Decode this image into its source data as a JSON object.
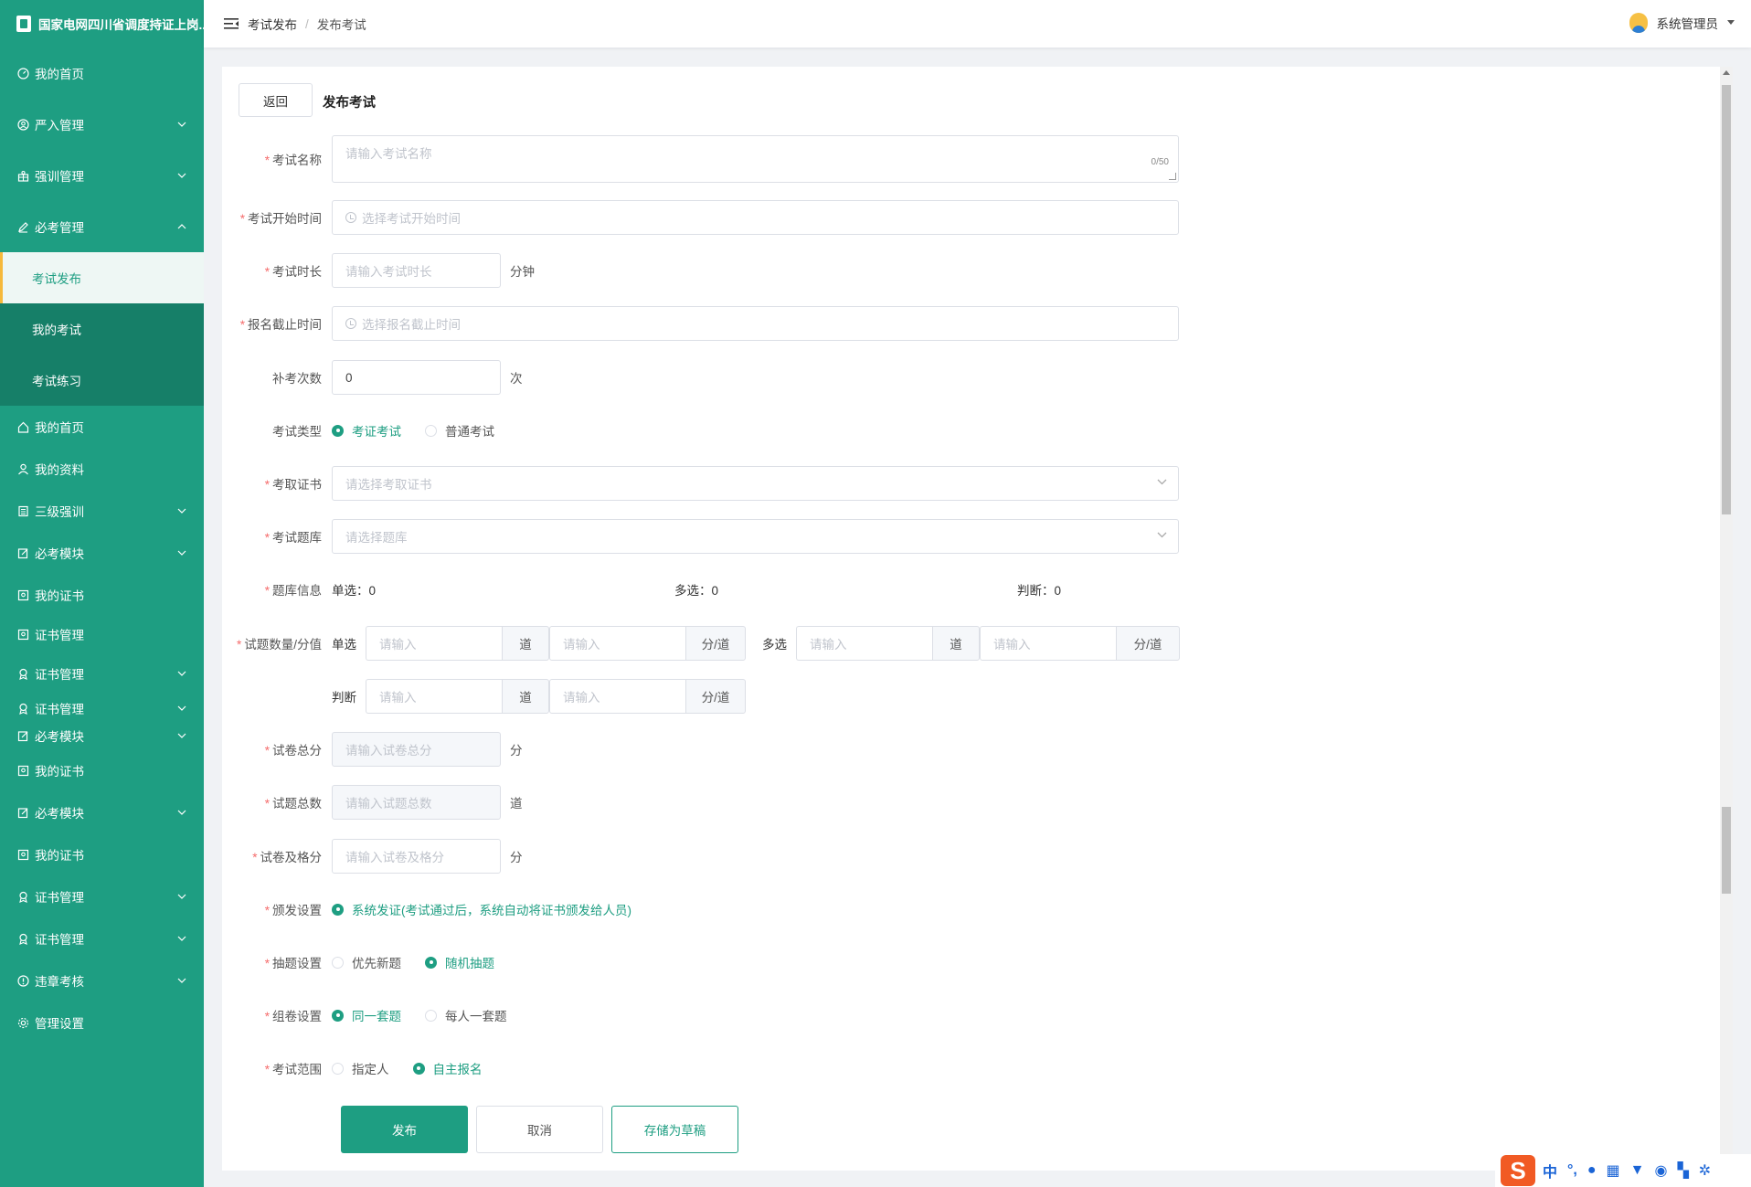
{
  "app": {
    "title": "国家电网四川省调度持证上岗..."
  },
  "header": {
    "breadcrumb": [
      "考试发布",
      "发布考试"
    ],
    "user_name": "系统管理员"
  },
  "sidebar": {
    "items": [
      {
        "label": "我的首页",
        "icon": "dashboard-icon",
        "chevron": false
      },
      {
        "label": "严入管理",
        "icon": "user-circle-icon",
        "chevron": true
      },
      {
        "label": "强训管理",
        "icon": "gift-icon",
        "chevron": true
      },
      {
        "label": "必考管理",
        "icon": "edit-icon",
        "chevron": true,
        "expanded": true
      }
    ],
    "sub_items": [
      {
        "label": "考试发布",
        "active": true
      },
      {
        "label": "我的考试",
        "active": false
      },
      {
        "label": "考试练习",
        "active": false
      }
    ],
    "items2": [
      {
        "label": "我的首页",
        "icon": "home-icon",
        "chevron": false
      },
      {
        "label": "我的资料",
        "icon": "user-icon",
        "chevron": false
      },
      {
        "label": "三级强训",
        "icon": "document-icon",
        "chevron": true
      },
      {
        "label": "必考模块",
        "icon": "edit-box-icon",
        "chevron": true
      },
      {
        "label": "我的证书",
        "icon": "certificate-icon",
        "chevron": false
      },
      {
        "label": "证书管理",
        "icon": "certificate-icon",
        "chevron": false
      },
      {
        "label": "证书管理",
        "icon": "badge-icon",
        "chevron": true
      },
      {
        "label": "证书管理",
        "icon": "badge-icon",
        "chevron": true
      },
      {
        "label": "必考模块",
        "icon": "edit-box-icon",
        "chevron": true
      },
      {
        "label": "我的证书",
        "icon": "certificate-icon",
        "chevron": false
      },
      {
        "label": "必考模块",
        "icon": "edit-box-icon",
        "chevron": true
      },
      {
        "label": "我的证书",
        "icon": "certificate-icon",
        "chevron": false
      },
      {
        "label": "证书管理",
        "icon": "badge-icon",
        "chevron": true
      },
      {
        "label": "证书管理",
        "icon": "badge-icon",
        "chevron": true
      },
      {
        "label": "违章考核",
        "icon": "alert-icon",
        "chevron": true
      },
      {
        "label": "管理设置",
        "icon": "settings-icon",
        "chevron": false
      }
    ]
  },
  "page": {
    "back_label": "返回",
    "title": "发布考试"
  },
  "form": {
    "exam_name": {
      "label": "考试名称",
      "placeholder": "请输入考试名称",
      "count": "0/50"
    },
    "start_time": {
      "label": "考试开始时间",
      "placeholder": "选择考试开始时间"
    },
    "duration": {
      "label": "考试时长",
      "placeholder": "请输入考试时长",
      "unit": "分钟"
    },
    "deadline": {
      "label": "报名截止时间",
      "placeholder": "选择报名截止时间"
    },
    "retake": {
      "label": "补考次数",
      "value": "0",
      "unit": "次"
    },
    "exam_type": {
      "label": "考试类型",
      "options": [
        "考证考试",
        "普通考试"
      ],
      "selected": 0
    },
    "certificate": {
      "label": "考取证书",
      "placeholder": "请选择考取证书"
    },
    "question_bank": {
      "label": "考试题库",
      "placeholder": "请选择题库"
    },
    "bank_info": {
      "label": "题库信息",
      "single": "单选：0",
      "multi": "多选：0",
      "judge": "判断：0"
    },
    "question_count": {
      "label": "试题数量/分值",
      "single_label": "单选",
      "multi_label": "多选",
      "judge_label": "判断",
      "placeholder": "请输入",
      "count_unit": "道",
      "score_unit": "分/道"
    },
    "total_score": {
      "label": "试卷总分",
      "placeholder": "请输入试卷总分",
      "unit": "分"
    },
    "total_questions": {
      "label": "试题总数",
      "placeholder": "请输入试题总数",
      "unit": "道"
    },
    "pass_score": {
      "label": "试卷及格分",
      "placeholder": "请输入试卷及格分",
      "unit": "分"
    },
    "issue": {
      "label": "颁发设置",
      "options": [
        "系统发证(考试通过后，系统自动将证书颁发给人员)"
      ],
      "selected": 0
    },
    "draw": {
      "label": "抽题设置",
      "options": [
        "优先新题",
        "随机抽题"
      ],
      "selected": 1
    },
    "compose": {
      "label": "组卷设置",
      "options": [
        "同一套题",
        "每人一套题"
      ],
      "selected": 0
    },
    "scope": {
      "label": "考试范围",
      "options": [
        "指定人",
        "自主报名"
      ],
      "selected": 1
    }
  },
  "buttons": {
    "publish": "发布",
    "cancel": "取消",
    "draft": "存储为草稿"
  },
  "ime": {
    "s": "S",
    "zh": "中"
  },
  "colors": {
    "primary": "#1e9e82",
    "sidebar_dark": "#167f68",
    "active_accent": "#f6b93b",
    "required": "#f56c6c"
  }
}
